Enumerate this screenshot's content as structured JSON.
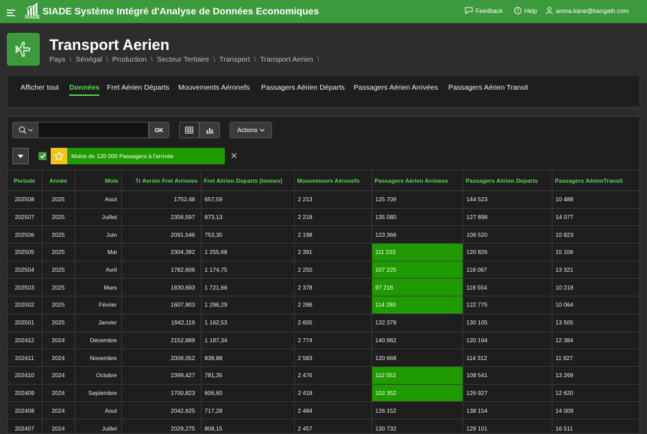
{
  "app": {
    "logo_text": "SIADE",
    "title": "SIADE Système Intégré d'Analyse de Données Economiques",
    "feedback": "Feedback",
    "help": "Help",
    "user": "arona.kane@bangath.com"
  },
  "page": {
    "title": "Transport Aerien",
    "breadcrumb": [
      "Pays",
      "Sénégal",
      "Production",
      "Secteur Tertiaire",
      "Transport",
      "Transport Aerien"
    ],
    "separator": "\\"
  },
  "tabs": [
    {
      "label": "Afficher tout",
      "active": false
    },
    {
      "label": "Données",
      "active": true
    },
    {
      "label": "Fret Aérien Départs",
      "active": false
    },
    {
      "label": "Mouvements Aéronefs",
      "active": false
    },
    {
      "label": "Passagers Aérien Départs",
      "active": false
    },
    {
      "label": "Passagers Aérien Arrivées",
      "active": false
    },
    {
      "label": "Passagers Aérien Transit",
      "active": false
    }
  ],
  "toolbar": {
    "search_value": "",
    "ok_label": "OK",
    "actions_label": "Actions"
  },
  "filter": {
    "label": "Moins de 120 000 Passagers à l'arrivée",
    "enabled": true,
    "color": "#1f9a00"
  },
  "table": {
    "headers": [
      "Periode",
      "Année",
      "Mois",
      "Tr Aerien Fret Arrivees",
      "Fret Aérien Departs (tonnes)",
      "Mouvemenrs Aéronefs",
      "Passagers Aérien Arrivees",
      "Passagers Aérien Departs",
      "Passagers AérienTransit"
    ],
    "rows": [
      {
        "periode": "202508",
        "annee": "2025",
        "mois": "Aout",
        "fret_arr": "1752,48",
        "fret_dep": "657,59",
        "mouv": "2 213",
        "pass_arr": "125 709",
        "pass_dep": "144 523",
        "transit": "10 488",
        "highlight": false
      },
      {
        "periode": "202507",
        "annee": "2025",
        "mois": "Juillet",
        "fret_arr": "2356,597",
        "fret_dep": "873,13",
        "mouv": "2 218",
        "pass_arr": "135 080",
        "pass_dep": "127 898",
        "transit": "14 077",
        "highlight": false
      },
      {
        "periode": "202506",
        "annee": "2025",
        "mois": "Juin",
        "fret_arr": "2091,546",
        "fret_dep": "753,35",
        "mouv": "2 198",
        "pass_arr": "123 366",
        "pass_dep": "106 520",
        "transit": "10 823",
        "highlight": false
      },
      {
        "periode": "202505",
        "annee": "2025",
        "mois": "Mai",
        "fret_arr": "2304,382",
        "fret_dep": "1 255,68",
        "mouv": "2 391",
        "pass_arr": "111 233",
        "pass_dep": "120 826",
        "transit": "15 106",
        "highlight": true
      },
      {
        "periode": "202504",
        "annee": "2025",
        "mois": "Avril",
        "fret_arr": "1782,606",
        "fret_dep": "1 174,75",
        "mouv": "2 250",
        "pass_arr": "107 225",
        "pass_dep": "118 067",
        "transit": "13 321",
        "highlight": true
      },
      {
        "periode": "202503",
        "annee": "2025",
        "mois": "Mars",
        "fret_arr": "1830,693",
        "fret_dep": "1 721,66",
        "mouv": "2 378",
        "pass_arr": "97 218",
        "pass_dep": "118 554",
        "transit": "10 218",
        "highlight": true
      },
      {
        "periode": "202502",
        "annee": "2025",
        "mois": "Février",
        "fret_arr": "1607,903",
        "fret_dep": "1 296,29",
        "mouv": "2 286",
        "pass_arr": "114 280",
        "pass_dep": "122 775",
        "transit": "10 064",
        "highlight": true
      },
      {
        "periode": "202501",
        "annee": "2025",
        "mois": "Janvier",
        "fret_arr": "1942,119",
        "fret_dep": "1 162,53",
        "mouv": "2 605",
        "pass_arr": "132 379",
        "pass_dep": "130 105",
        "transit": "13 505",
        "highlight": false
      },
      {
        "periode": "202412",
        "annee": "2024",
        "mois": "Décembre",
        "fret_arr": "2152,889",
        "fret_dep": "1 187,34",
        "mouv": "2 774",
        "pass_arr": "140 962",
        "pass_dep": "120 194",
        "transit": "12 384",
        "highlight": false
      },
      {
        "periode": "202411",
        "annee": "2024",
        "mois": "Novembre",
        "fret_arr": "2006,052",
        "fret_dep": "838,88",
        "mouv": "2 583",
        "pass_arr": "120 668",
        "pass_dep": "114 312",
        "transit": "11 927",
        "highlight": false
      },
      {
        "periode": "202410",
        "annee": "2024",
        "mois": "Octobre",
        "fret_arr": "2399,427",
        "fret_dep": "781,35",
        "mouv": "2 476",
        "pass_arr": "112 052",
        "pass_dep": "108 541",
        "transit": "13 269",
        "highlight": true
      },
      {
        "periode": "202409",
        "annee": "2024",
        "mois": "Septembre",
        "fret_arr": "1700,823",
        "fret_dep": "606,60",
        "mouv": "2 418",
        "pass_arr": "102 352",
        "pass_dep": "126 927",
        "transit": "12 620",
        "highlight": true
      },
      {
        "periode": "202408",
        "annee": "2024",
        "mois": "Aout",
        "fret_arr": "2042,625",
        "fret_dep": "717,28",
        "mouv": "2 484",
        "pass_arr": "126 152",
        "pass_dep": "138 154",
        "transit": "14 009",
        "highlight": false
      },
      {
        "periode": "202407",
        "annee": "2024",
        "mois": "Juillet",
        "fret_arr": "2029,275",
        "fret_dep": "808,15",
        "mouv": "2 457",
        "pass_arr": "130 732",
        "pass_dep": "129 101",
        "transit": "16 511",
        "highlight": false
      }
    ]
  },
  "icons": {
    "menu": "hamburger-icon",
    "logo": "chart-logo-icon",
    "feedback": "chat-bubble-icon",
    "help": "question-circle-icon",
    "user": "user-icon",
    "page": "airplane-icon",
    "search": "search-icon",
    "table_view": "table-icon",
    "chart_view": "bar-chart-icon",
    "filter_toggle": "caret-down-icon",
    "filter_star": "star-icon",
    "filter_close": "close-icon"
  }
}
